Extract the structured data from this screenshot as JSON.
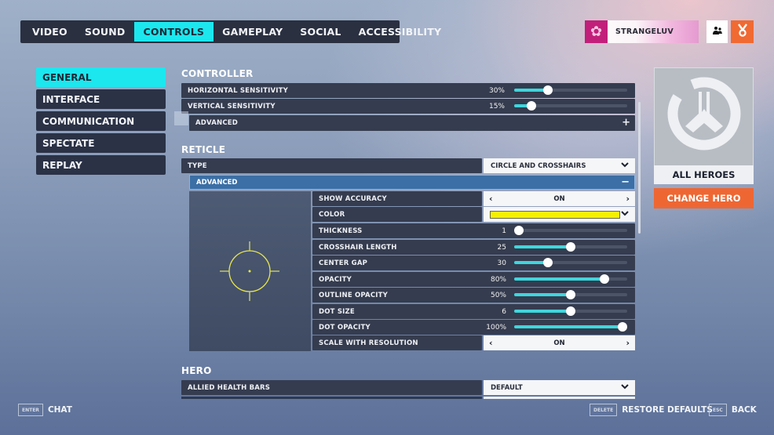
{
  "top_tabs": [
    {
      "label": "VIDEO",
      "active": false
    },
    {
      "label": "SOUND",
      "active": false
    },
    {
      "label": "CONTROLS",
      "active": true
    },
    {
      "label": "GAMEPLAY",
      "active": false
    },
    {
      "label": "SOCIAL",
      "active": false
    },
    {
      "label": "ACCESSIBILITY",
      "active": false
    }
  ],
  "player": {
    "name": "STRANGELUV",
    "avatar_icon": "cherry-blossom-icon",
    "social_icon": "group-icon",
    "rewards_icon": "medal-icon"
  },
  "sidebar": {
    "items": [
      {
        "label": "GENERAL",
        "active": true
      },
      {
        "label": "INTERFACE",
        "active": false
      },
      {
        "label": "COMMUNICATION",
        "active": false
      },
      {
        "label": "SPECTATE",
        "active": false
      },
      {
        "label": "REPLAY",
        "active": false
      }
    ]
  },
  "controller": {
    "title": "CONTROLLER",
    "horizontal_sensitivity": {
      "label": "HORIZONTAL SENSITIVITY",
      "value": "30%",
      "fraction": 0.3
    },
    "vertical_sensitivity": {
      "label": "VERTICAL SENSITIVITY",
      "value": "15%",
      "fraction": 0.15
    },
    "advanced": {
      "label": "ADVANCED",
      "icon": "+"
    }
  },
  "reticle": {
    "title": "RETICLE",
    "type": {
      "label": "TYPE",
      "value": "CIRCLE AND CROSSHAIRS"
    },
    "advanced": {
      "label": "ADVANCED",
      "icon": "−"
    },
    "show_accuracy": {
      "label": "SHOW ACCURACY",
      "value": "ON"
    },
    "color": {
      "label": "COLOR",
      "value": "#f5f000"
    },
    "sliders": [
      {
        "key": "thickness",
        "label": "THICKNESS",
        "value": "1",
        "fraction": 0.0
      },
      {
        "key": "crosshair_length",
        "label": "CROSSHAIR LENGTH",
        "value": "25",
        "fraction": 0.5
      },
      {
        "key": "center_gap",
        "label": "CENTER GAP",
        "value": "30",
        "fraction": 0.3
      },
      {
        "key": "opacity",
        "label": "OPACITY",
        "value": "80%",
        "fraction": 0.8
      },
      {
        "key": "outline_opacity",
        "label": "OUTLINE OPACITY",
        "value": "50%",
        "fraction": 0.5
      },
      {
        "key": "dot_size",
        "label": "DOT SIZE",
        "value": "6",
        "fraction": 0.5
      },
      {
        "key": "dot_opacity",
        "label": "DOT OPACITY",
        "value": "100%",
        "fraction": 1.0
      }
    ],
    "scale_with_resolution": {
      "label": "SCALE WITH RESOLUTION",
      "value": "ON"
    }
  },
  "hero_section": {
    "title": "HERO",
    "allied_health_bars": {
      "label": "ALLIED HEALTH BARS",
      "value": "DEFAULT"
    }
  },
  "hero_card": {
    "name": "ALL HEROES",
    "change_label": "CHANGE HERO"
  },
  "footer": {
    "chat": {
      "key": "ENTER",
      "label": "CHAT"
    },
    "restore": {
      "key": "DELETE",
      "label": "RESTORE DEFAULTS"
    },
    "back": {
      "key": "ESC",
      "label": "BACK"
    }
  },
  "colors": {
    "accent_cyan": "#1ce7ee",
    "slider_fill": "#3fd6dd",
    "orange": "#ee6733",
    "advanced_blue": "#3b6fa5"
  }
}
